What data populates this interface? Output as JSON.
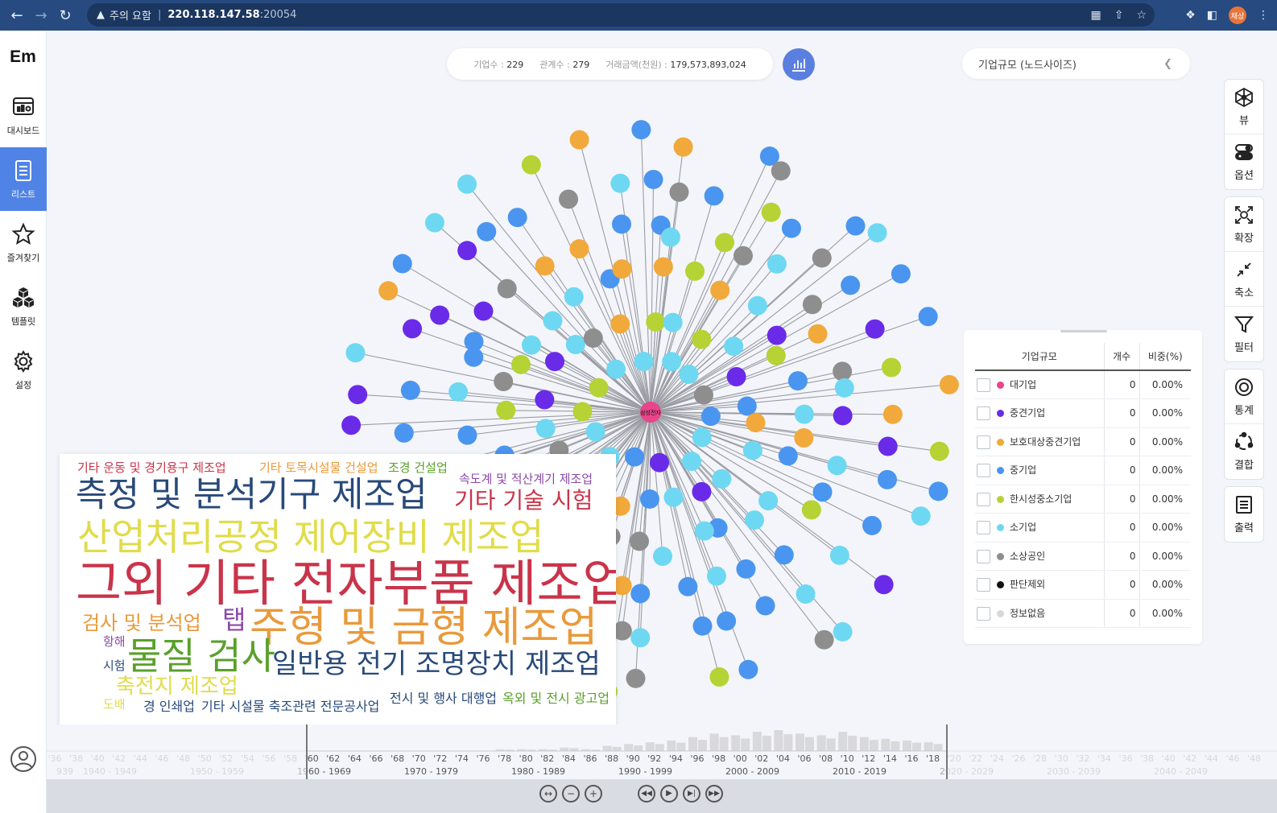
{
  "browser": {
    "warning_text": "주의 요함",
    "url_host": "220.118.147.58",
    "url_port": ":20054",
    "profile_label": "채상"
  },
  "sidebar": {
    "logo": "Em",
    "items": [
      {
        "label": "대시보드",
        "icon": "dashboard-icon"
      },
      {
        "label": "리스트",
        "icon": "list-icon",
        "active": true
      },
      {
        "label": "즐겨찾기",
        "icon": "star-icon"
      },
      {
        "label": "템플릿",
        "icon": "cubes-icon"
      },
      {
        "label": "설정",
        "icon": "gear-icon"
      }
    ]
  },
  "stats": {
    "companies_label": "기업수 :",
    "companies_value": "229",
    "relations_label": "관계수 :",
    "relations_value": "279",
    "amount_label": "거래금액(천원) :",
    "amount_value": "179,573,893,024"
  },
  "node_size_select": {
    "value": "기업규모 (노드사이즈)"
  },
  "tools": {
    "view": "뷰",
    "options": "옵션",
    "expand": "확장",
    "shrink": "축소",
    "filter": "필터",
    "stats": "통계",
    "combine": "결합",
    "print": "출력"
  },
  "legend": {
    "headers": [
      "기업규모",
      "개수",
      "비중(%)"
    ],
    "rows": [
      {
        "label": "대기업",
        "count": "0",
        "ratio": "0.00%",
        "color": "#e8458b"
      },
      {
        "label": "중견기업",
        "count": "0",
        "ratio": "0.00%",
        "color": "#6a2be8"
      },
      {
        "label": "보호대상중견기업",
        "count": "0",
        "ratio": "0.00%",
        "color": "#f2a93b"
      },
      {
        "label": "중기업",
        "count": "0",
        "ratio": "0.00%",
        "color": "#4a95ef"
      },
      {
        "label": "한시성중소기업",
        "count": "0",
        "ratio": "0.00%",
        "color": "#b5d335"
      },
      {
        "label": "소기업",
        "count": "0",
        "ratio": "0.00%",
        "color": "#6ed8f2"
      },
      {
        "label": "소상공인",
        "count": "0",
        "ratio": "0.00%",
        "color": "#8e8e8e"
      },
      {
        "label": "판단제외",
        "count": "0",
        "ratio": "0.00%",
        "color": "#111111"
      },
      {
        "label": "정보없음",
        "count": "0",
        "ratio": "0.00%",
        "color": "#d8d8d8"
      }
    ]
  },
  "graph": {
    "center_label": "삼성전자",
    "center_color": "#e8458b"
  },
  "word_cloud": [
    {
      "text": "기타 운동 및 경기용구 제조업",
      "color": "#c9344a"
    },
    {
      "text": "기타 토목시설물 건설업",
      "color": "#e89a3c"
    },
    {
      "text": "조경 건설업",
      "color": "#5aa02c"
    },
    {
      "text": "속도계 및 적산계기 제조업",
      "color": "#8a4aa8"
    },
    {
      "text": "측정 및 분석기구 제조업",
      "color": "#284a7a"
    },
    {
      "text": "기타 기술 시험",
      "color": "#c9344a"
    },
    {
      "text": "산업처리공정 제어장비 제조업",
      "color": "#e0dc4a"
    },
    {
      "text": "그외 기타 전자부품 제조업",
      "color": "#c9344a"
    },
    {
      "text": "검사 및 분석업",
      "color": "#e89a3c"
    },
    {
      "text": "탭",
      "color": "#8a4aa8"
    },
    {
      "text": "주형 및 금형 제조업",
      "color": "#e89a3c"
    },
    {
      "text": "항해",
      "color": "#8a4aa8"
    },
    {
      "text": "물질 검사",
      "color": "#5aa02c"
    },
    {
      "text": "시험",
      "color": "#284a7a"
    },
    {
      "text": "일반용 전기 조명장치 제조업",
      "color": "#284a7a"
    },
    {
      "text": "축전지 제조업",
      "color": "#e0dc4a"
    },
    {
      "text": "도배",
      "color": "#e0dc4a"
    },
    {
      "text": "경 인쇄업",
      "color": "#284a7a"
    },
    {
      "text": "기타 시설물 축조관련 전문공사업",
      "color": "#284a7a"
    },
    {
      "text": "전시 및 행사 대행업",
      "color": "#284a7a"
    },
    {
      "text": "옥외 및 전시 광고업",
      "color": "#5aa02c"
    }
  ],
  "timeline": {
    "years": [
      "'36",
      "'38",
      "'40",
      "'42",
      "'44",
      "'46",
      "'48",
      "'50",
      "'52",
      "'54",
      "'56",
      "'58",
      "'60",
      "'62",
      "'64",
      "'66",
      "'68",
      "'70",
      "'72",
      "'74",
      "'76",
      "'78",
      "'80",
      "'82",
      "'84",
      "'86",
      "'88",
      "'90",
      "'92",
      "'94",
      "'96",
      "'98",
      "'00",
      "'02",
      "'04",
      "'06",
      "'08",
      "'10",
      "'12",
      "'14",
      "'16",
      "'18",
      "'20",
      "'22",
      "'24",
      "'26",
      "'28",
      "'30",
      "'32",
      "'34",
      "'36",
      "'38",
      "'40",
      "'42",
      "'44",
      "'46",
      "'48"
    ],
    "decades": [
      "939",
      "1940 - 1949",
      "1950 - 1959",
      "1960 - 1969",
      "1970 - 1979",
      "1980 - 1989",
      "1990 - 1999",
      "2000 - 2009",
      "2010 - 2019",
      "2020 - 2029",
      "2030 - 2039",
      "2040 - 2049"
    ],
    "counts": [
      0,
      0,
      0,
      0,
      0,
      0,
      0,
      0,
      0,
      0,
      0,
      0,
      0,
      0,
      0,
      0,
      0,
      0,
      0,
      0,
      0,
      1,
      1,
      1,
      2,
      1,
      3,
      4,
      5,
      6,
      8,
      10,
      9,
      11,
      12,
      10,
      9,
      11,
      8,
      7,
      6,
      5,
      0,
      0,
      0,
      0,
      0,
      0,
      0,
      0,
      0,
      0,
      0,
      0,
      0,
      0,
      0
    ]
  }
}
